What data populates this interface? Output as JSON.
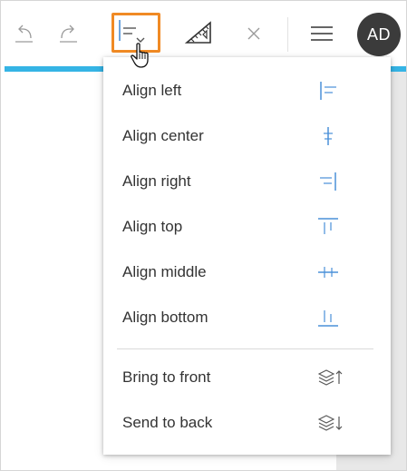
{
  "toolbar": {
    "icons": [
      "undo-icon",
      "redo-icon",
      "align-left-icon",
      "chevron-down-icon",
      "ruler-icon",
      "close-icon",
      "hamburger-icon"
    ],
    "avatar_initials": "AD",
    "highlight_color": "#f08a24",
    "accent_bar_color": "#35b4e5"
  },
  "menu": {
    "icon_color": "#4a90d9",
    "items": [
      {
        "label": "Align left",
        "icon": "align-left-icon"
      },
      {
        "label": "Align center",
        "icon": "align-center-icon"
      },
      {
        "label": "Align right",
        "icon": "align-right-icon"
      },
      {
        "label": "Align top",
        "icon": "align-top-icon"
      },
      {
        "label": "Align middle",
        "icon": "align-middle-icon"
      },
      {
        "label": "Align bottom",
        "icon": "align-bottom-icon"
      },
      {
        "label": "Bring to front",
        "icon": "bring-to-front-icon"
      },
      {
        "label": "Send to back",
        "icon": "send-to-back-icon"
      }
    ]
  }
}
